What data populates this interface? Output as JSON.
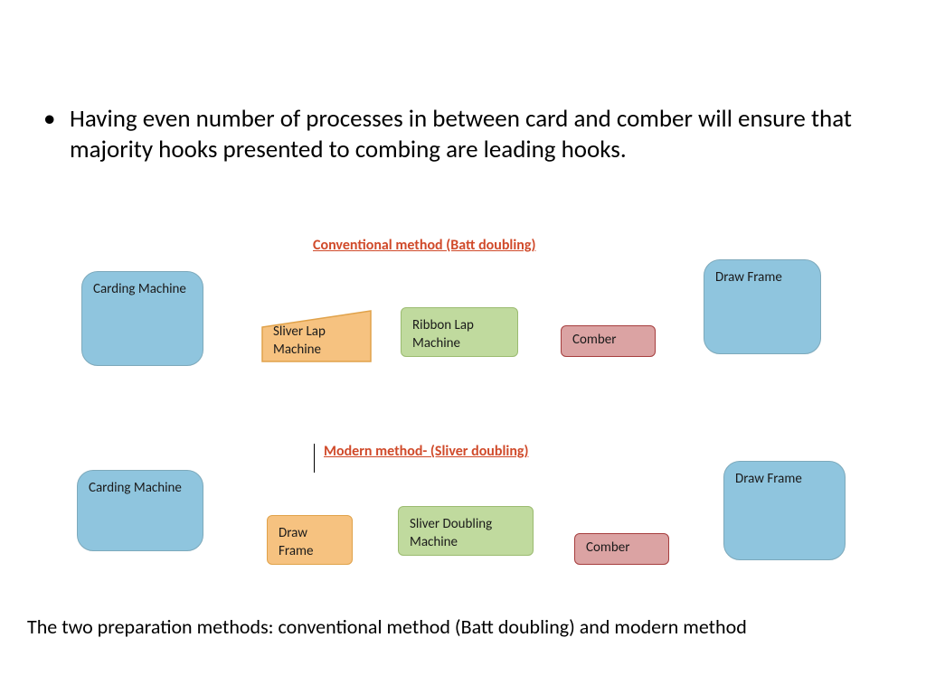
{
  "bullet": "Having even number of processes in between card and comber will ensure that majority hooks presented to combing are leading hooks.",
  "heading1": "Conventional method (Batt doubling)",
  "heading2": "Modern method-  (Sliver doubling)",
  "row1": {
    "card": "Carding Machine",
    "sliver": "Sliver Lap Machine",
    "ribbon": "Ribbon Lap Machine",
    "comber": "Comber",
    "draw": "Draw Frame"
  },
  "row2": {
    "card": "Carding Machine",
    "draw": "Draw Frame",
    "sd": "Sliver Doubling Machine",
    "comber": "Comber",
    "drawR": "Draw Frame"
  },
  "footer": "The two preparation methods: conventional method (Batt doubling) and modern method",
  "colors": {
    "blue": "#8fc5de",
    "orange": "#f6c280",
    "green": "#c0da9e",
    "pink": "#dba3a3",
    "headingText": "#d04a2a"
  }
}
